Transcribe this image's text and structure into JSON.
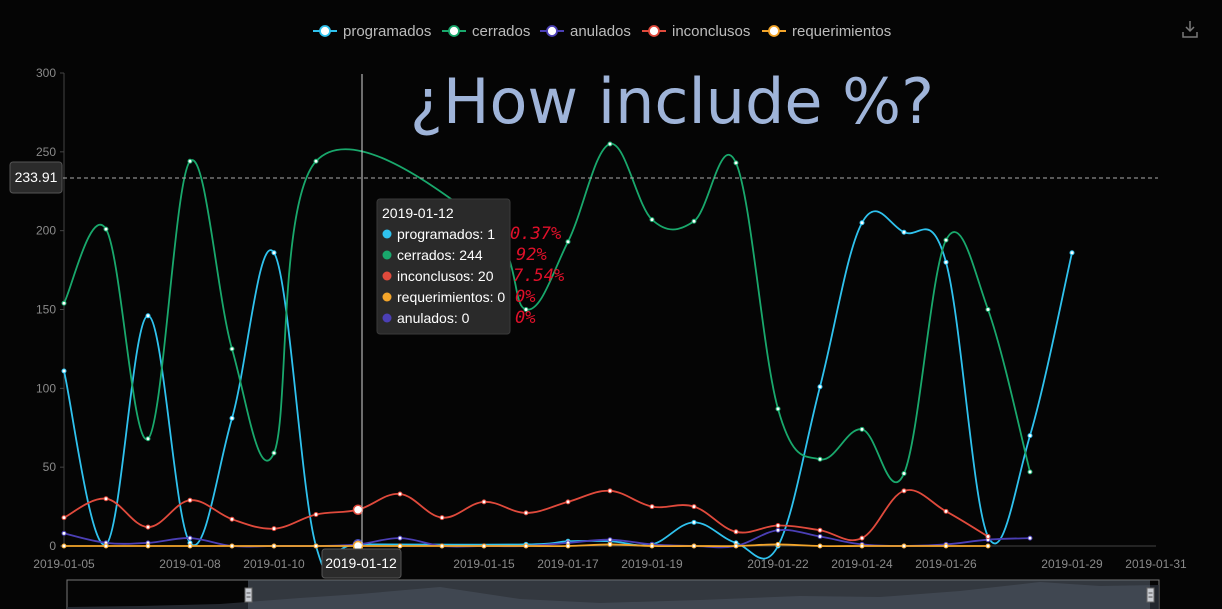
{
  "toolbar": {
    "download_icon": "download-icon"
  },
  "annotation_title": "¿How include %?",
  "axis_pointer_value": "233.91",
  "tooltip": {
    "date": "2019-01-12",
    "rows": [
      {
        "label": "programados: 1",
        "color": "#2fc2ee",
        "pct": "0.37%"
      },
      {
        "label": "cerrados: 244",
        "color": "#19a86c",
        "pct": "92%"
      },
      {
        "label": "inconclusos: 20",
        "color": "#e04a3c",
        "pct": "7.54%"
      },
      {
        "label": "requerimientos: 0",
        "color": "#f3a52a",
        "pct": "0%"
      },
      {
        "label": "anulados: 0",
        "color": "#4b3fb5",
        "pct": "0%"
      }
    ]
  },
  "chart_data": {
    "type": "line",
    "smooth": true,
    "ylim": [
      0,
      300
    ],
    "y_ticks": [
      0,
      50,
      100,
      150,
      200,
      250,
      300
    ],
    "highlighted_category": "2019-01-12",
    "x": [
      "2019-01-05",
      "2019-01-06",
      "2019-01-07",
      "2019-01-08",
      "2019-01-09",
      "2019-01-10",
      "2019-01-11",
      "2019-01-12",
      "2019-01-13",
      "2019-01-14",
      "2019-01-15",
      "2019-01-16",
      "2019-01-17",
      "2019-01-18",
      "2019-01-19",
      "2019-01-20",
      "2019-01-21",
      "2019-01-22",
      "2019-01-23",
      "2019-01-24",
      "2019-01-25",
      "2019-01-26",
      "2019-01-27",
      "2019-01-28",
      "2019-01-29",
      "2019-01-30",
      "2019-01-31"
    ],
    "x_tick_labels": [
      "2019-01-05",
      "2019-01-08",
      "2019-01-10",
      "2019-01-12",
      "2019-01-15",
      "2019-01-17",
      "2019-01-19",
      "2019-01-22",
      "2019-01-24",
      "2019-01-26",
      "2019-01-29",
      "2019-01-31"
    ],
    "legend_position": "top-center",
    "series": [
      {
        "name": "programados",
        "color": "#2fc2ee",
        "values": [
          111,
          1,
          146,
          2,
          81,
          186,
          0,
          1,
          null,
          null,
          null,
          1,
          3,
          3,
          1,
          15,
          2,
          0,
          101,
          205,
          199,
          180,
          6,
          70,
          186,
          null,
          null
        ]
      },
      {
        "name": "cerrados",
        "color": "#19a86c",
        "values": [
          154,
          201,
          68,
          244,
          125,
          59,
          244,
          null,
          null,
          null,
          205,
          150,
          193,
          255,
          207,
          206,
          243,
          87,
          55,
          74,
          46,
          194,
          150,
          47,
          null,
          null,
          null
        ]
      },
      {
        "name": "anulados",
        "color": "#4b3fb5",
        "values": [
          8,
          2,
          2,
          5,
          0,
          0,
          0,
          1,
          5,
          0,
          0,
          0,
          2,
          4,
          1,
          0,
          0,
          10,
          6,
          1,
          0,
          1,
          4,
          5,
          null,
          null,
          null
        ]
      },
      {
        "name": "inconclusos",
        "color": "#e04a3c",
        "values": [
          18,
          30,
          12,
          29,
          17,
          11,
          20,
          23,
          33,
          18,
          28,
          21,
          28,
          35,
          25,
          25,
          9,
          13,
          10,
          5,
          35,
          22,
          6,
          null,
          null,
          null,
          null
        ]
      },
      {
        "name": "requerimientos",
        "color": "#f3a52a",
        "values": [
          0,
          0,
          0,
          0,
          0,
          0,
          0,
          0,
          0,
          0,
          0,
          0,
          0,
          1,
          0,
          0,
          0,
          1,
          0,
          0,
          0,
          0,
          0,
          null,
          null,
          null,
          null
        ]
      }
    ]
  }
}
